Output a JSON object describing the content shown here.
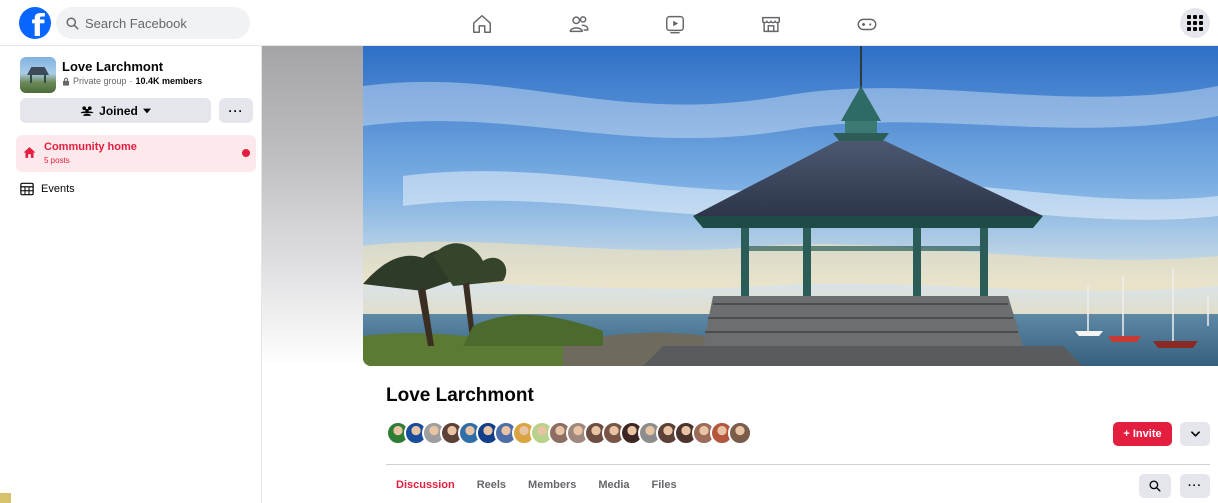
{
  "topbar": {
    "logo_letter": "f",
    "search_placeholder": "Search Facebook",
    "nav_icons": [
      "home-icon",
      "friends-icon",
      "video-icon",
      "marketplace-icon",
      "gaming-icon"
    ],
    "menu_icon": "grid-menu-icon"
  },
  "sidebar": {
    "group_name": "Love Larchmont",
    "privacy": "Private group",
    "separator": " · ",
    "members_count": "10.4K members",
    "joined_label": "Joined",
    "more_label": "···",
    "nav": [
      {
        "label": "Community home",
        "sub": "5 posts",
        "active": true,
        "icon": "home-icon"
      },
      {
        "label": "Events",
        "icon": "calendar-icon"
      }
    ]
  },
  "main": {
    "group_title": "Love Larchmont",
    "invite_label": "+ Invite",
    "tabs": [
      {
        "label": "Discussion",
        "active": true
      },
      {
        "label": "Reels"
      },
      {
        "label": "Members"
      },
      {
        "label": "Media"
      },
      {
        "label": "Files"
      }
    ],
    "more_label": "···",
    "member_avatar_colors": [
      "#2e7d32",
      "#1a4c9c",
      "#9e9e9e",
      "#5d4037",
      "#2f6ea8",
      "#123e8a",
      "#4f6da8",
      "#d9a441",
      "#b7d38b",
      "#8d6e63",
      "#a1887f",
      "#6d4c41",
      "#795548",
      "#3e2723",
      "#8d8d8d",
      "#5d4037",
      "#4e342e",
      "#9c6b5a",
      "#b5563e",
      "#7a5c4b"
    ]
  },
  "colors": {
    "accent": "#e41e3f",
    "fb_blue": "#0866ff"
  }
}
